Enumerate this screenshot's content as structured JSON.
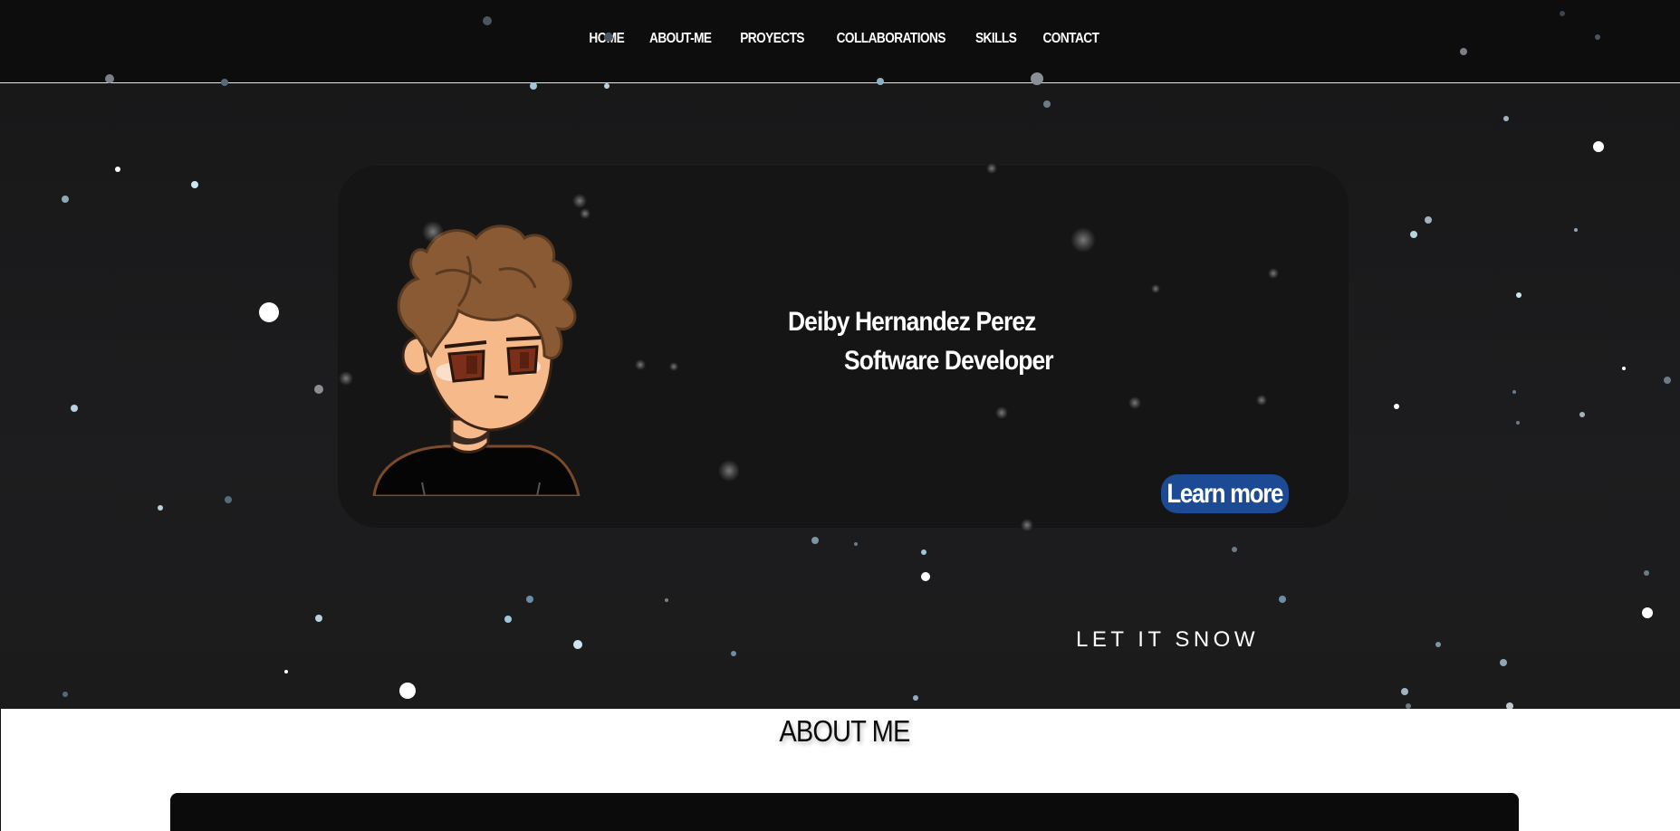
{
  "nav": {
    "items": [
      {
        "label": "HOME"
      },
      {
        "label": "ABOUT-ME"
      },
      {
        "label": "PROYECTS"
      },
      {
        "label": "COLLABORATIONS"
      },
      {
        "label": "SKILLS"
      },
      {
        "label": "CONTACT"
      }
    ]
  },
  "hero": {
    "name": "Deiby Hernandez Perez",
    "role": "Software Developer",
    "cta_label": "Learn more",
    "snow_label": "LET IT SNOW"
  },
  "about": {
    "title": "ABOUT ME"
  },
  "colors": {
    "nav_background": "#0d0d0e",
    "hero_background": "#1b1b1c",
    "card_background": "#151516",
    "cta_background": "#1c4a94",
    "about_background": "#ffffff",
    "about_box": "#0b0b0b"
  },
  "icons": {
    "avatar": "cartoon-boy-avatar"
  }
}
